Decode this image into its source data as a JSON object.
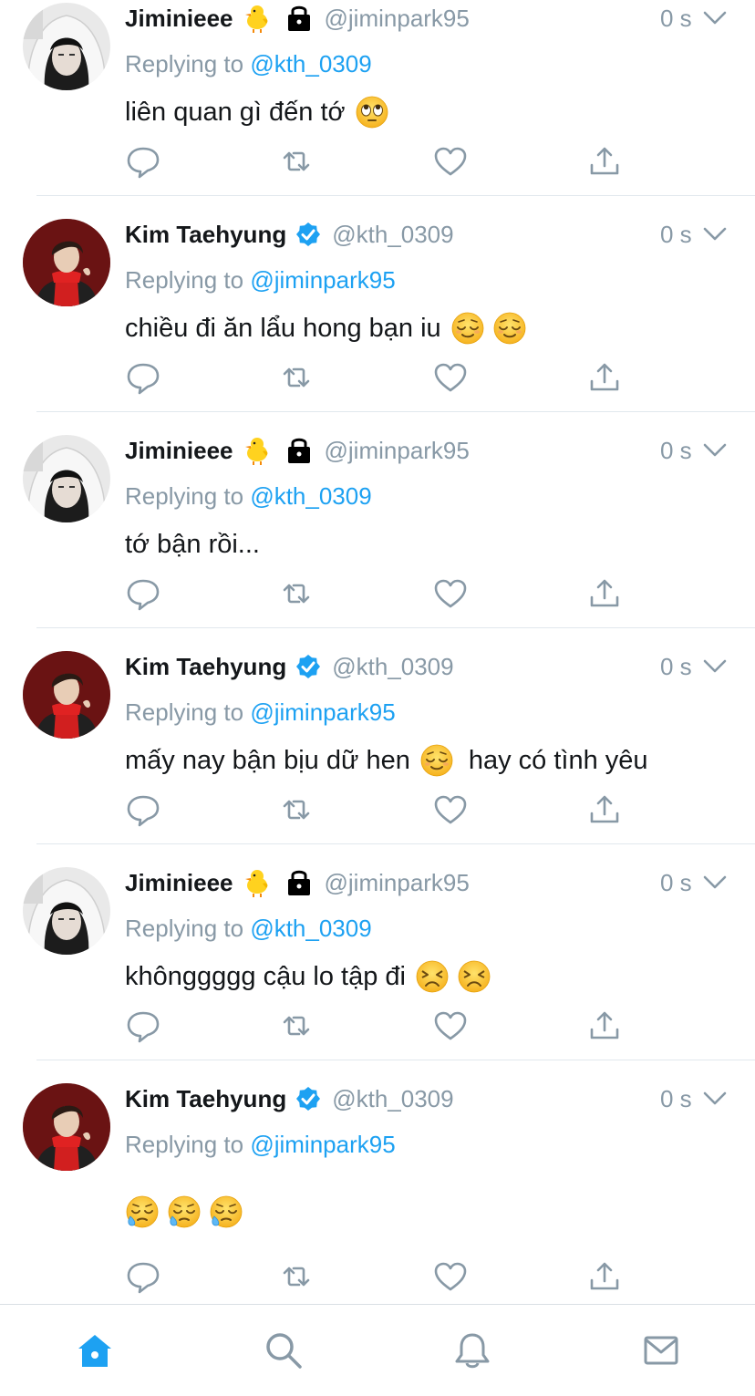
{
  "colors": {
    "link": "#1da1f2",
    "muted": "#8899a6",
    "text": "#14171a",
    "verified": "#1da1f2",
    "active_tab": "#1da1f2"
  },
  "tweets": [
    {
      "name": "Jiminieee",
      "badges": [
        "baby-chick-emoji",
        "lock-icon"
      ],
      "handle": "@jiminpark95",
      "time": "0 s",
      "replying_prefix": "Replying to",
      "replying_to": "@kth_0309",
      "text": "liên quan gì đến tớ",
      "emojis": [
        "face-with-rolling-eyes"
      ]
    },
    {
      "name": "Kim Taehyung",
      "badges": [
        "verified-icon"
      ],
      "handle": "@kth_0309",
      "time": "0 s",
      "replying_prefix": "Replying to",
      "replying_to": "@jiminpark95",
      "text": "chiều đi ăn lẩu hong bạn iu",
      "emojis": [
        "relieved-face",
        "relieved-face"
      ]
    },
    {
      "name": "Jiminieee",
      "badges": [
        "baby-chick-emoji",
        "lock-icon"
      ],
      "handle": "@jiminpark95",
      "time": "0 s",
      "replying_prefix": "Replying to",
      "replying_to": "@kth_0309",
      "text": "tớ bận rồi...",
      "emojis": []
    },
    {
      "name": "Kim Taehyung",
      "badges": [
        "verified-icon"
      ],
      "handle": "@kth_0309",
      "time": "0 s",
      "replying_prefix": "Replying to",
      "replying_to": "@jiminpark95",
      "text": "mấy nay bận bịu dữ hen",
      "text_after": "hay có tình yêu",
      "emojis": [
        "relieved-face"
      ]
    },
    {
      "name": "Jiminieee",
      "badges": [
        "baby-chick-emoji",
        "lock-icon"
      ],
      "handle": "@jiminpark95",
      "time": "0 s",
      "replying_prefix": "Replying to",
      "replying_to": "@kth_0309",
      "text": "khônggggg cậu lo tập đi",
      "emojis": [
        "persevering-face",
        "persevering-face"
      ]
    },
    {
      "name": "Kim Taehyung",
      "badges": [
        "verified-icon"
      ],
      "handle": "@kth_0309",
      "time": "0 s",
      "replying_prefix": "Replying to",
      "replying_to": "@jiminpark95",
      "text": "",
      "emojis": [
        "sleepy-face",
        "sleepy-face",
        "sleepy-face"
      ]
    }
  ],
  "action_icons": [
    "reply-icon",
    "retweet-icon",
    "like-icon",
    "share-icon"
  ],
  "tabbar": {
    "items": [
      "home-icon",
      "search-icon",
      "notifications-icon",
      "messages-icon"
    ],
    "active": "home-icon"
  }
}
